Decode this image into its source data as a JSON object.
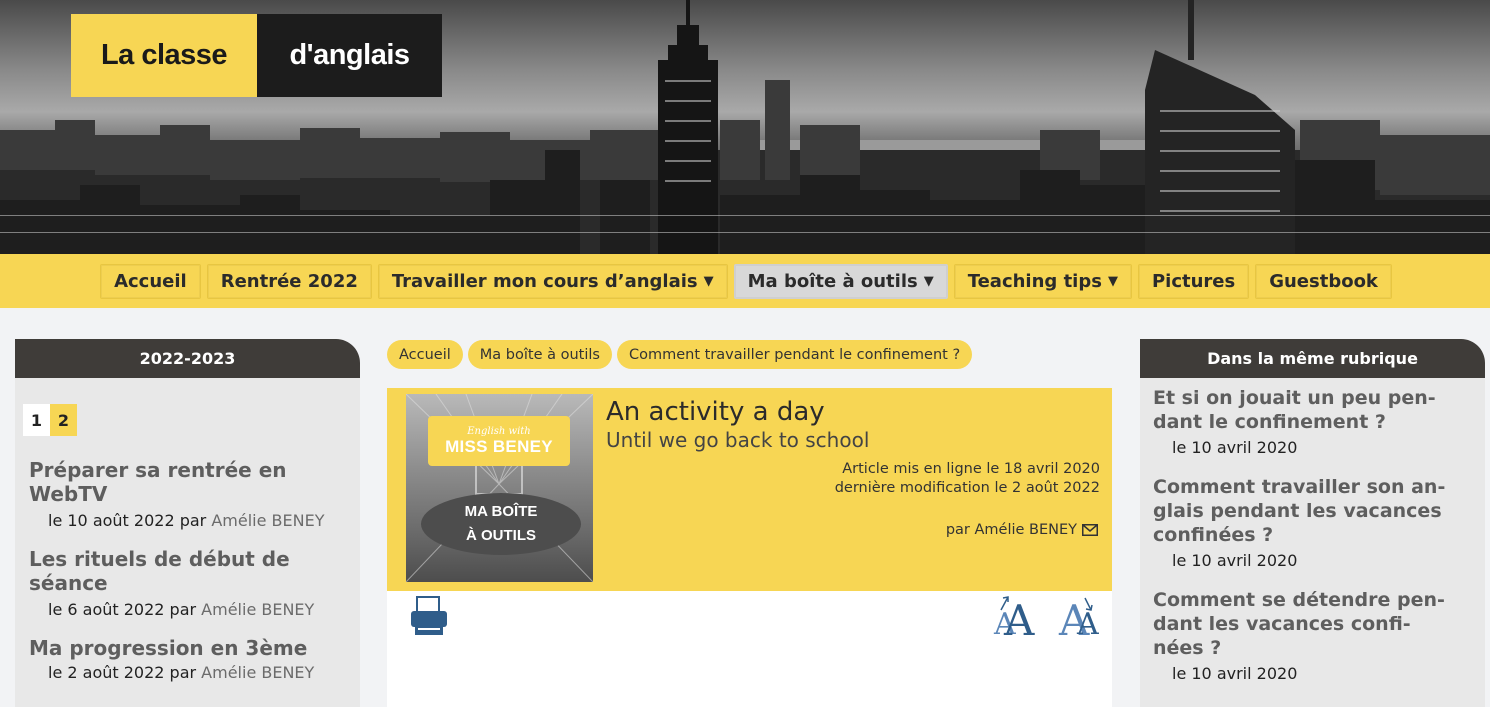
{
  "site": {
    "logo_part1": "La classe",
    "logo_part2": "d'anglais"
  },
  "nav": {
    "items": [
      {
        "label": "Accueil",
        "has_menu": false,
        "active": false
      },
      {
        "label": "Rentrée 2022",
        "has_menu": false,
        "active": false
      },
      {
        "label": "Travailler mon cours d’anglais",
        "has_menu": true,
        "active": false
      },
      {
        "label": "Ma boîte à outils",
        "has_menu": true,
        "active": true
      },
      {
        "label": "Teaching tips",
        "has_menu": true,
        "active": false
      },
      {
        "label": "Pictures",
        "has_menu": false,
        "active": false
      },
      {
        "label": "Guestbook",
        "has_menu": false,
        "active": false
      }
    ],
    "caret": "▼"
  },
  "left_panel": {
    "title": "2022-2023",
    "pager": {
      "current": "1",
      "next": "2"
    },
    "articles": [
      {
        "title": "Préparer sa rentrée en WebTV",
        "date": "le 10 août 2022 par",
        "author": "Amélie BENEY"
      },
      {
        "title": "Les rituels de début de séance",
        "date": "le 6 août 2022 par",
        "author": "Amélie BENEY"
      },
      {
        "title": "Ma progression en 3ème",
        "date": "le 2 août 2022 par",
        "author": "Amélie BENEY"
      }
    ]
  },
  "breadcrumb": [
    "Accueil",
    "Ma boîte à outils",
    "Comment travailler pendant le confinement ?"
  ],
  "article": {
    "thumb_small": "English with",
    "thumb_big": "MISS BENEY",
    "thumb_oval_1": "MA BOÎTE",
    "thumb_oval_2": "À OUTILS",
    "title": "An activity a day",
    "subtitle": "Until we go back to school",
    "published": "Article mis en ligne le 18 avril 2020",
    "modified": "dernière modification le 2 août 2022",
    "byline": "par Amélie BENEY"
  },
  "right_panel": {
    "title": "Dans la même rubrique",
    "articles": [
      {
        "title_lines": [
          "Et si on jouait un peu pen-",
          "dant le confinement ?"
        ],
        "date": "le 10 avril 2020"
      },
      {
        "title_lines": [
          "Comment travailler son an-",
          "glais pendant les vacances",
          "confinées ?"
        ],
        "date": "le 10 avril 2020"
      },
      {
        "title_lines": [
          "Comment se détendre pen-",
          "dant les vacances confi-",
          "nées ?"
        ],
        "date": "le 10 avril 2020"
      }
    ]
  },
  "icons": {
    "print": "printer-icon",
    "font_increase": "font-increase-icon",
    "font_decrease": "font-decrease-icon",
    "mail": "mail-icon"
  },
  "colors": {
    "accent_yellow": "#f7d654",
    "panel_header": "#3f3c39",
    "link_grey": "#5e5e5e",
    "icon_blue": "#2f5d8a"
  }
}
